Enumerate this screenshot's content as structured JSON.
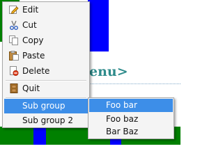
{
  "background": {
    "heading_fragment": "enu>",
    "colors": {
      "green": "#008000",
      "blue": "#0000ff",
      "heading": "#2e8b8b",
      "highlight": "#3d8ee8"
    }
  },
  "context_menu": {
    "items": [
      {
        "label": "Edit",
        "icon": "edit-pencil-icon"
      },
      {
        "label": "Cut",
        "icon": "scissors-icon"
      },
      {
        "label": "Copy",
        "icon": "copy-pages-icon"
      },
      {
        "label": "Paste",
        "icon": "clipboard-icon"
      },
      {
        "label": "Delete",
        "icon": "delete-page-icon"
      },
      {
        "label": "Quit",
        "icon": "door-icon"
      },
      {
        "label": "Sub group",
        "icon": null,
        "active": true
      },
      {
        "label": "Sub group 2",
        "icon": null
      }
    ]
  },
  "submenu": {
    "items": [
      {
        "label": "Foo bar",
        "active": true
      },
      {
        "label": "Foo baz"
      },
      {
        "label": "Bar Baz"
      }
    ]
  }
}
